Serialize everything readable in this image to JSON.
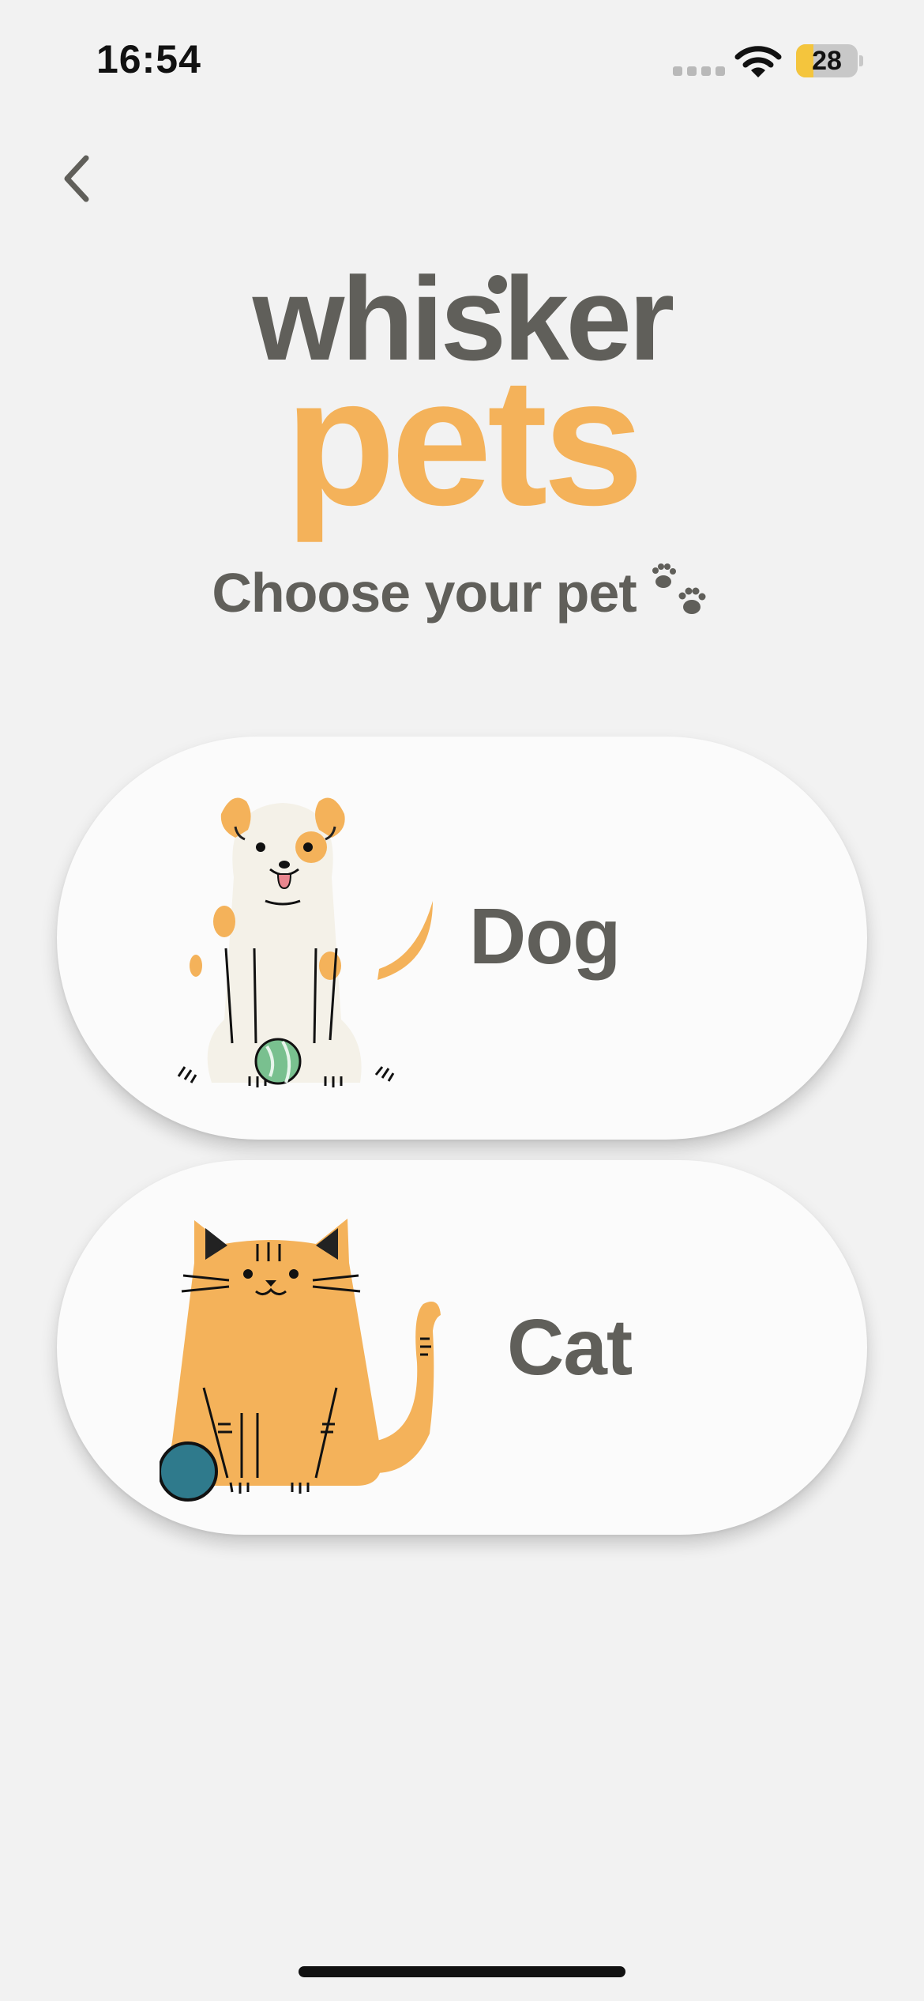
{
  "status_bar": {
    "time": "16:54",
    "battery_level": 28,
    "battery_text": "28",
    "battery_color": "#f4c53d"
  },
  "nav": {
    "back_icon": "chevron-left-icon"
  },
  "logo": {
    "line1": "whisker",
    "line2": "pets",
    "line1_color": "#605f5a",
    "line2_color": "#f4b25a"
  },
  "page": {
    "title": "Choose your pet",
    "title_icon": "paw-prints-icon"
  },
  "pets": [
    {
      "label": "Dog",
      "illustration": "dog-illustration"
    },
    {
      "label": "Cat",
      "illustration": "cat-illustration"
    }
  ],
  "colors": {
    "background": "#f2f2f2",
    "card": "#fbfbfb",
    "text": "#605f5a",
    "accent": "#f4b25a"
  }
}
